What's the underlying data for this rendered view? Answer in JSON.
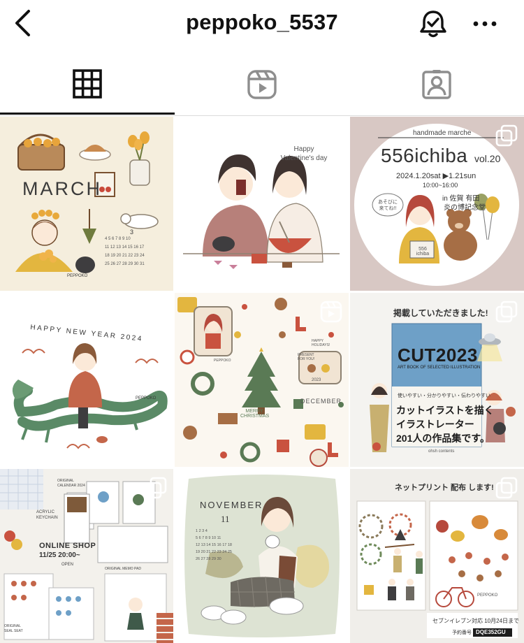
{
  "header": {
    "username": "peppoko_5537",
    "back_icon": "chevron-left-icon",
    "bell_icon": "bell-check-icon",
    "more_icon": "more-horizontal-icon"
  },
  "tabs": [
    {
      "name": "posts-grid",
      "icon": "grid-icon",
      "active": true
    },
    {
      "name": "reels",
      "icon": "reels-icon",
      "active": false
    },
    {
      "name": "tagged",
      "icon": "tagged-user-icon",
      "active": false
    }
  ],
  "posts": [
    {
      "caption": "MARCH",
      "month": "3",
      "signature": "PEPPOKO",
      "bg": "#f5eedd",
      "badge": null
    },
    {
      "caption": "Happy Valentine's day",
      "bg": "#ffffff",
      "badge": null
    },
    {
      "caption": "handmade marche",
      "title": "556ichiba",
      "vol": "vol.20",
      "dates": "2024.1.20sat ▶1.21sun",
      "time": "10:00~16:00",
      "place1": "in 佐賀 有田",
      "place2": "炎の博記念堂",
      "bubble": "あそびに 来てね!!",
      "box_label": "556 ichiba",
      "bg": "#d8c8c4",
      "badge": "carousel"
    },
    {
      "caption": "HAPPY NEW YEAR 2024",
      "signature": "PEPPOKO",
      "bg": "#ffffff",
      "badge": null
    },
    {
      "caption": "MERRY CHRISTMAS",
      "month": "DECEMBER",
      "year": "2023",
      "sign1": "PEPPOKO",
      "sign2": "HAPPY HOLIDAYS!",
      "sign3": "PRESENT FOR YOU!",
      "bg": "#fbf7f0",
      "badge": "reel"
    },
    {
      "banner": "掲載していただきました!",
      "title": "CUT2023",
      "subtitle": "ART BOOK OF SELECTED ILLUSTRATION",
      "small": "使いやすい・分かりやすい・伝わりやすい",
      "line1": "カットイラストを描く",
      "line2": "イラストレーター",
      "line3": "201人の作品集です。",
      "publisher": "ohsh contents",
      "bg": "#f4f3f0",
      "badge": "carousel"
    },
    {
      "label1": "ORIGINAL CALENDAR 2024",
      "label2": "ACRYLIC KEYCHAIN",
      "label3": "ONLINE SHOP",
      "label4": "11/25  20:00~",
      "label5": "OPEN",
      "label6": "ORIGINAL MEMO PAD",
      "label7": "ORIGINAL SEAL SEAT",
      "bg": "#f3f1ec",
      "badge": "carousel"
    },
    {
      "caption": "NOVEMBER",
      "month": "11",
      "bg": "#dde3d3",
      "badge": null
    },
    {
      "banner": "ネットプリント 配布 します!",
      "note": "セブンイレブン対応 10月24日まで",
      "code_label": "予約番号",
      "code": "DQE352GU",
      "sheet_title": "PEPPOKO",
      "bg": "#f0eeea",
      "badge": "carousel"
    }
  ]
}
